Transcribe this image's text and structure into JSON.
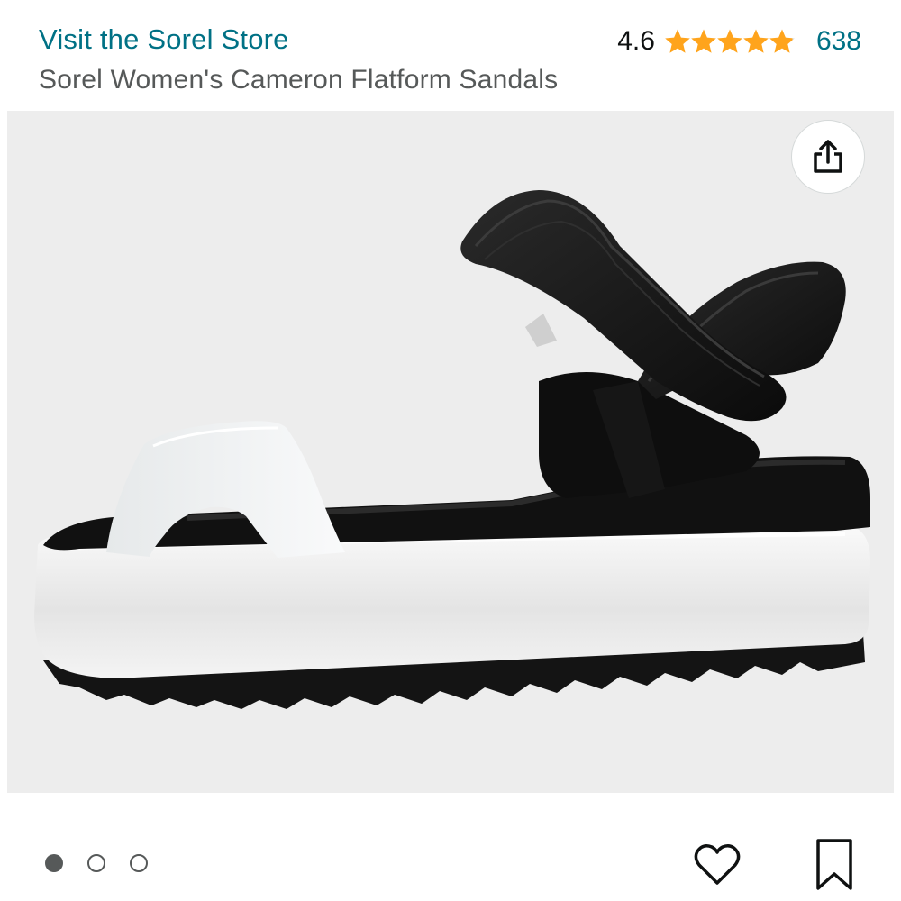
{
  "header": {
    "store_link": "Visit the Sorel Store",
    "rating": "4.6",
    "review_count": "638",
    "product_title": "Sorel Women's Cameron Flatform Sandals"
  },
  "stars": {
    "icon": "star-icon",
    "filled_color": "#FFA41C",
    "empty_color": "#d5d9d9",
    "fraction": 0.92
  },
  "gallery": {
    "current_index": 1,
    "total_images": 3,
    "share_icon": "share-icon"
  },
  "actions": {
    "favorite_icon": "heart-icon",
    "save_icon": "bookmark-icon"
  },
  "colors": {
    "link": "#007185",
    "subtitle": "#565959",
    "panel": "#ededed"
  }
}
